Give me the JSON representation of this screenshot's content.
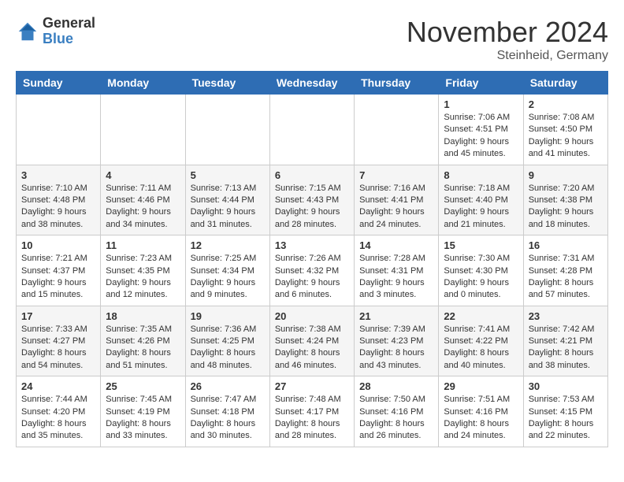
{
  "logo": {
    "general": "General",
    "blue": "Blue"
  },
  "title": "November 2024",
  "location": "Steinheid, Germany",
  "days_of_week": [
    "Sunday",
    "Monday",
    "Tuesday",
    "Wednesday",
    "Thursday",
    "Friday",
    "Saturday"
  ],
  "weeks": [
    [
      {
        "day": "",
        "info": ""
      },
      {
        "day": "",
        "info": ""
      },
      {
        "day": "",
        "info": ""
      },
      {
        "day": "",
        "info": ""
      },
      {
        "day": "",
        "info": ""
      },
      {
        "day": "1",
        "info": "Sunrise: 7:06 AM\nSunset: 4:51 PM\nDaylight: 9 hours\nand 45 minutes."
      },
      {
        "day": "2",
        "info": "Sunrise: 7:08 AM\nSunset: 4:50 PM\nDaylight: 9 hours\nand 41 minutes."
      }
    ],
    [
      {
        "day": "3",
        "info": "Sunrise: 7:10 AM\nSunset: 4:48 PM\nDaylight: 9 hours\nand 38 minutes."
      },
      {
        "day": "4",
        "info": "Sunrise: 7:11 AM\nSunset: 4:46 PM\nDaylight: 9 hours\nand 34 minutes."
      },
      {
        "day": "5",
        "info": "Sunrise: 7:13 AM\nSunset: 4:44 PM\nDaylight: 9 hours\nand 31 minutes."
      },
      {
        "day": "6",
        "info": "Sunrise: 7:15 AM\nSunset: 4:43 PM\nDaylight: 9 hours\nand 28 minutes."
      },
      {
        "day": "7",
        "info": "Sunrise: 7:16 AM\nSunset: 4:41 PM\nDaylight: 9 hours\nand 24 minutes."
      },
      {
        "day": "8",
        "info": "Sunrise: 7:18 AM\nSunset: 4:40 PM\nDaylight: 9 hours\nand 21 minutes."
      },
      {
        "day": "9",
        "info": "Sunrise: 7:20 AM\nSunset: 4:38 PM\nDaylight: 9 hours\nand 18 minutes."
      }
    ],
    [
      {
        "day": "10",
        "info": "Sunrise: 7:21 AM\nSunset: 4:37 PM\nDaylight: 9 hours\nand 15 minutes."
      },
      {
        "day": "11",
        "info": "Sunrise: 7:23 AM\nSunset: 4:35 PM\nDaylight: 9 hours\nand 12 minutes."
      },
      {
        "day": "12",
        "info": "Sunrise: 7:25 AM\nSunset: 4:34 PM\nDaylight: 9 hours\nand 9 minutes."
      },
      {
        "day": "13",
        "info": "Sunrise: 7:26 AM\nSunset: 4:32 PM\nDaylight: 9 hours\nand 6 minutes."
      },
      {
        "day": "14",
        "info": "Sunrise: 7:28 AM\nSunset: 4:31 PM\nDaylight: 9 hours\nand 3 minutes."
      },
      {
        "day": "15",
        "info": "Sunrise: 7:30 AM\nSunset: 4:30 PM\nDaylight: 9 hours\nand 0 minutes."
      },
      {
        "day": "16",
        "info": "Sunrise: 7:31 AM\nSunset: 4:28 PM\nDaylight: 8 hours\nand 57 minutes."
      }
    ],
    [
      {
        "day": "17",
        "info": "Sunrise: 7:33 AM\nSunset: 4:27 PM\nDaylight: 8 hours\nand 54 minutes."
      },
      {
        "day": "18",
        "info": "Sunrise: 7:35 AM\nSunset: 4:26 PM\nDaylight: 8 hours\nand 51 minutes."
      },
      {
        "day": "19",
        "info": "Sunrise: 7:36 AM\nSunset: 4:25 PM\nDaylight: 8 hours\nand 48 minutes."
      },
      {
        "day": "20",
        "info": "Sunrise: 7:38 AM\nSunset: 4:24 PM\nDaylight: 8 hours\nand 46 minutes."
      },
      {
        "day": "21",
        "info": "Sunrise: 7:39 AM\nSunset: 4:23 PM\nDaylight: 8 hours\nand 43 minutes."
      },
      {
        "day": "22",
        "info": "Sunrise: 7:41 AM\nSunset: 4:22 PM\nDaylight: 8 hours\nand 40 minutes."
      },
      {
        "day": "23",
        "info": "Sunrise: 7:42 AM\nSunset: 4:21 PM\nDaylight: 8 hours\nand 38 minutes."
      }
    ],
    [
      {
        "day": "24",
        "info": "Sunrise: 7:44 AM\nSunset: 4:20 PM\nDaylight: 8 hours\nand 35 minutes."
      },
      {
        "day": "25",
        "info": "Sunrise: 7:45 AM\nSunset: 4:19 PM\nDaylight: 8 hours\nand 33 minutes."
      },
      {
        "day": "26",
        "info": "Sunrise: 7:47 AM\nSunset: 4:18 PM\nDaylight: 8 hours\nand 30 minutes."
      },
      {
        "day": "27",
        "info": "Sunrise: 7:48 AM\nSunset: 4:17 PM\nDaylight: 8 hours\nand 28 minutes."
      },
      {
        "day": "28",
        "info": "Sunrise: 7:50 AM\nSunset: 4:16 PM\nDaylight: 8 hours\nand 26 minutes."
      },
      {
        "day": "29",
        "info": "Sunrise: 7:51 AM\nSunset: 4:16 PM\nDaylight: 8 hours\nand 24 minutes."
      },
      {
        "day": "30",
        "info": "Sunrise: 7:53 AM\nSunset: 4:15 PM\nDaylight: 8 hours\nand 22 minutes."
      }
    ]
  ]
}
